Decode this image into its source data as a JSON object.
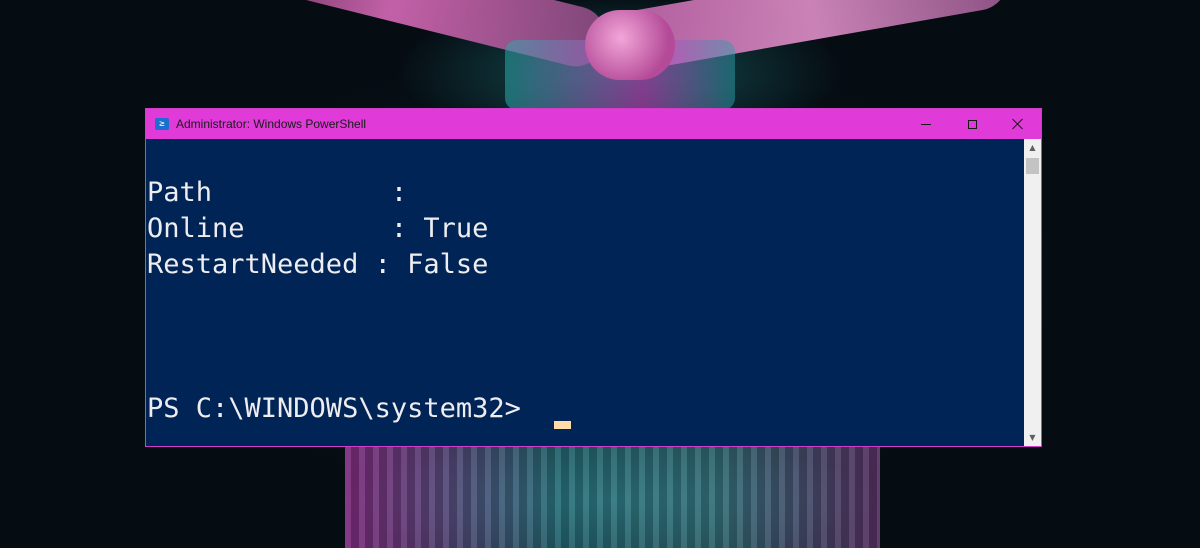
{
  "window": {
    "title": "Administrator: Windows PowerShell",
    "icon": "powershell-icon",
    "icon_glyph": "≥",
    "titlebar_color": "#e03ad8",
    "console_background": "#012456",
    "console_foreground": "#eeedf0",
    "cursor_color": "#fedba9"
  },
  "caption_buttons": {
    "minimize": "minimize-icon",
    "maximize": "maximize-icon",
    "close": "close-icon"
  },
  "console": {
    "lines": [
      "Path           :",
      "Online         : True",
      "RestartNeeded : False",
      "PS C:\\WINDOWS\\system32>"
    ]
  },
  "scrollbar": {
    "up_glyph": "▲",
    "down_glyph": "▼"
  }
}
